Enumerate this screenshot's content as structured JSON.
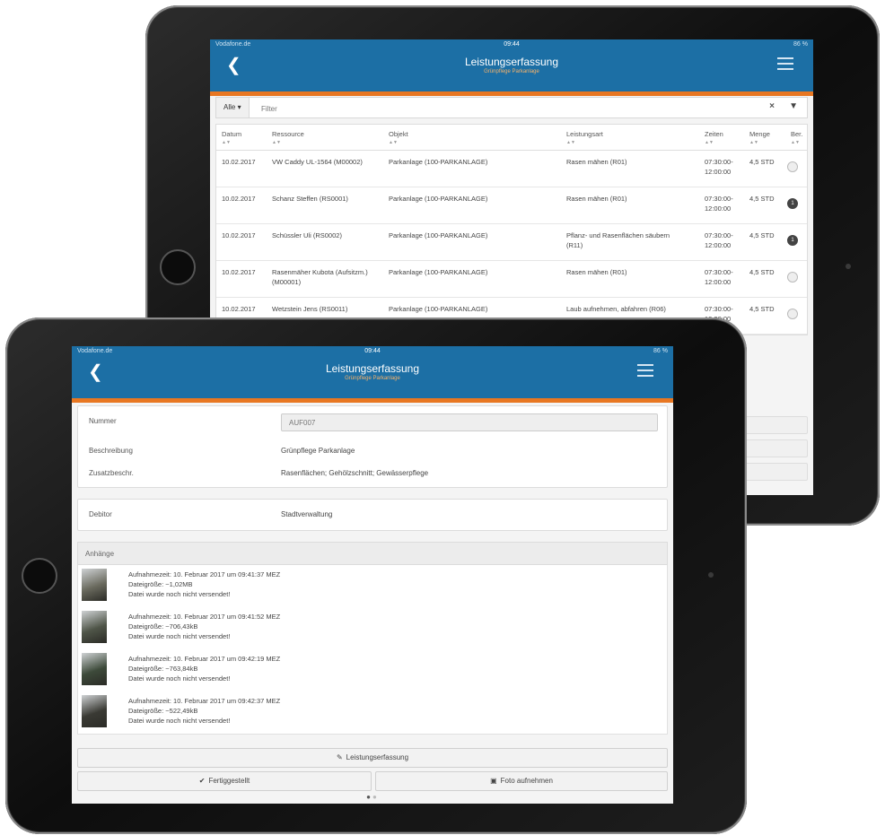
{
  "back_device": {
    "status": {
      "carrier": "Vodafone.de",
      "time": "09:44",
      "battery": "86 %"
    },
    "header": {
      "back_icon": "chevron-left-icon",
      "title": "Leistungserfassung",
      "subtitle": "Grünpflege Parkanlage",
      "menu_icon": "hamburger-icon"
    },
    "filter": {
      "scope_label": "Alle ▾",
      "placeholder": "Filter",
      "clear_icon": "×",
      "funnel_icon": "▼"
    },
    "table": {
      "columns": [
        {
          "label": "Datum",
          "sort": "▲▼"
        },
        {
          "label": "Ressource",
          "sort": "▲▼"
        },
        {
          "label": "Objekt",
          "sort": "▲▼"
        },
        {
          "label": "Leistungsart",
          "sort": "▲▼"
        },
        {
          "label": "Zeiten",
          "sort": "▲▼"
        },
        {
          "label": "Menge",
          "sort": "▲▼"
        },
        {
          "label": "Ber.",
          "sort": "▲▼"
        }
      ],
      "rows": [
        {
          "datum": "10.02.2017",
          "ressource": "VW Caddy UL-1564 (M00002)",
          "objekt": "Parkanlage (100-PARKANLAGE)",
          "leistungsart": "Rasen mähen (R01)",
          "zeiten": "07:30:00-\n12:00:00",
          "menge": "4,5 STD",
          "ber": ""
        },
        {
          "datum": "10.02.2017",
          "ressource": "Schanz Steffen (RS0001)",
          "objekt": "Parkanlage (100-PARKANLAGE)",
          "leistungsart": "Rasen mähen (R01)",
          "zeiten": "07:30:00-\n12:00:00",
          "menge": "4,5 STD",
          "ber": "1"
        },
        {
          "datum": "10.02.2017",
          "ressource": "Schüssler Uli (RS0002)",
          "objekt": "Parkanlage (100-PARKANLAGE)",
          "leistungsart": "Pflanz- und Rasenflächen säubern\n(R11)",
          "zeiten": "07:30:00-\n12:00:00",
          "menge": "4,5 STD",
          "ber": "1"
        },
        {
          "datum": "10.02.2017",
          "ressource": "Rasenmäher Kubota (Aufsitzm.)\n(M00001)",
          "objekt": "Parkanlage (100-PARKANLAGE)",
          "leistungsart": "Rasen mähen (R01)",
          "zeiten": "07:30:00-\n12:00:00",
          "menge": "4,5 STD",
          "ber": ""
        },
        {
          "datum": "10.02.2017",
          "ressource": "Wetzstein Jens (RS0011)",
          "objekt": "Parkanlage (100-PARKANLAGE)",
          "leistungsart": "Laub aufnehmen, abfahren (R06)",
          "zeiten": "07:30:00-\n12:00:00",
          "menge": "4,5 STD",
          "ber": ""
        }
      ]
    }
  },
  "front_device": {
    "status": {
      "carrier": "Vodafone.de",
      "time": "09:44",
      "battery": "86 %"
    },
    "header": {
      "back_icon": "chevron-left-icon",
      "title": "Leistungserfassung",
      "subtitle": "Grünpflege Parkanlage",
      "menu_icon": "hamburger-icon"
    },
    "form": {
      "nummer_label": "Nummer",
      "nummer_value": "AUF007",
      "beschreibung_label": "Beschreibung",
      "beschreibung_value": "Grünpflege Parkanlage",
      "zusatz_label": "Zusatzbeschr.",
      "zusatz_value": "Rasenflächen; Gehölzschnitt; Gewässerpflege",
      "debitor_label": "Debitor",
      "debitor_value": "Stadtverwaltung"
    },
    "attachments": {
      "header": "Anhänge",
      "items": [
        {
          "time": "Aufnahmezeit: 10. Februar 2017 um 09:41:37 MEZ",
          "size": "Dateigröße: ~1,02MB",
          "status": "Datei wurde noch nicht versendet!"
        },
        {
          "time": "Aufnahmezeit: 10. Februar 2017 um 09:41:52 MEZ",
          "size": "Dateigröße: ~706,43kB",
          "status": "Datei wurde noch nicht versendet!"
        },
        {
          "time": "Aufnahmezeit: 10. Februar 2017 um 09:42:19 MEZ",
          "size": "Dateigröße: ~763,84kB",
          "status": "Datei wurde noch nicht versendet!"
        },
        {
          "time": "Aufnahmezeit: 10. Februar 2017 um 09:42:37 MEZ",
          "size": "Dateigröße: ~522,49kB",
          "status": "Datei wurde noch nicht versendet!"
        }
      ]
    },
    "buttons": {
      "leistungserfassung": "Leistungserfassung",
      "fertiggestellt": "Fertiggestellt",
      "foto": "Foto aufnehmen"
    },
    "pager": {
      "dots": "●●",
      "active_page": 1,
      "page_count": 2
    }
  },
  "colors": {
    "header": "#1c6fa5",
    "accent": "#e87722"
  }
}
